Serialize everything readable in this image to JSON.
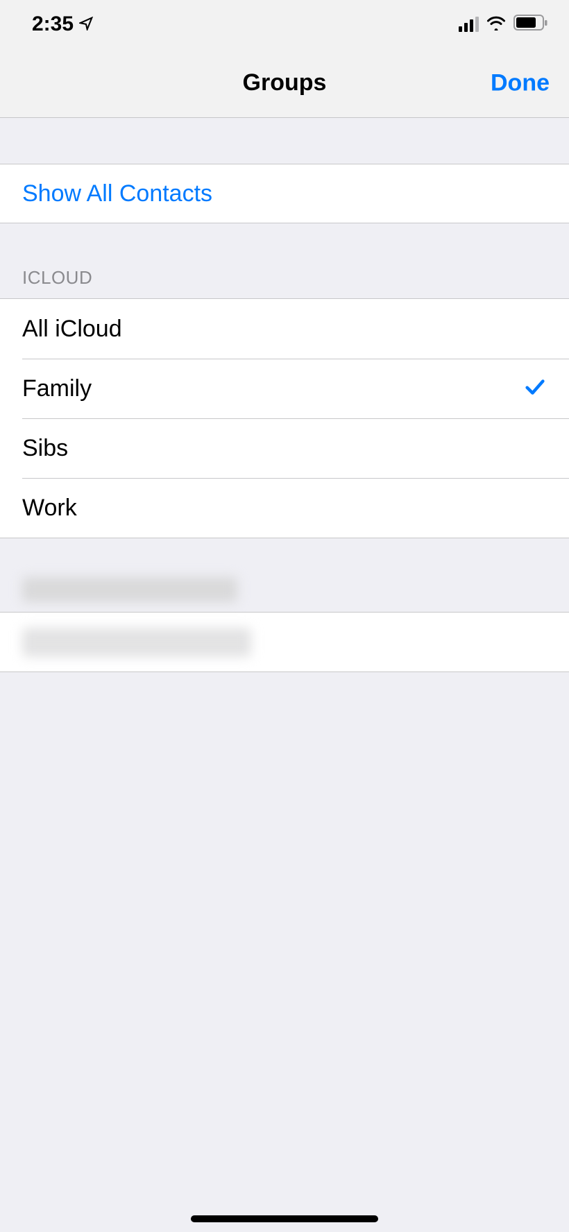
{
  "status_bar": {
    "time": "2:35"
  },
  "nav": {
    "title": "Groups",
    "done_label": "Done"
  },
  "show_all_label": "Show All Contacts",
  "section_header": "ICLOUD",
  "groups": [
    {
      "label": "All iCloud",
      "checked": false
    },
    {
      "label": "Family",
      "checked": true
    },
    {
      "label": "Sibs",
      "checked": false
    },
    {
      "label": "Work",
      "checked": false
    }
  ]
}
